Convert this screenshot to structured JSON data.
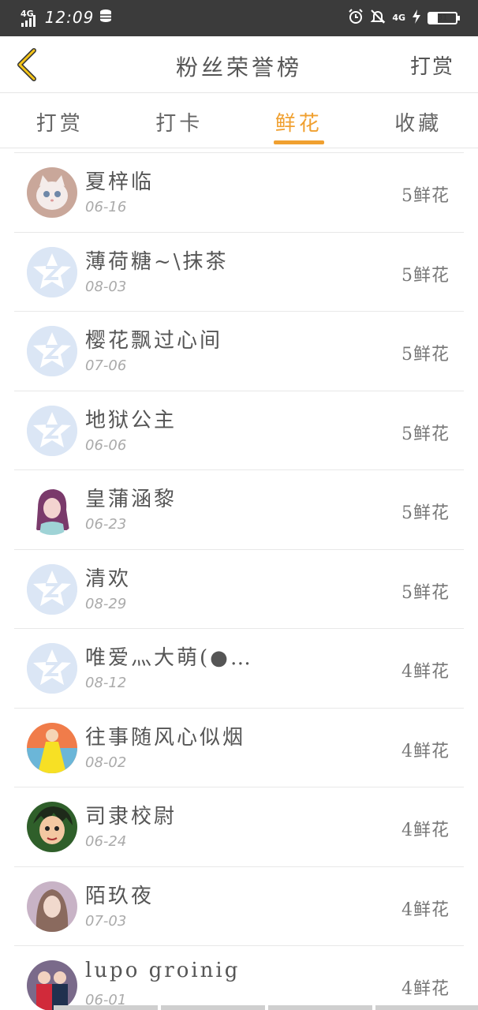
{
  "status_bar": {
    "network": "4G",
    "time": "12:09",
    "network_right": "4G",
    "battery": "31",
    "battery_level": 0.31
  },
  "header": {
    "title": "粉丝荣誉榜",
    "action": "打赏"
  },
  "tabs": [
    {
      "label": "打赏",
      "active": false
    },
    {
      "label": "打卡",
      "active": false
    },
    {
      "label": "鲜花",
      "active": true
    },
    {
      "label": "收藏",
      "active": false
    }
  ],
  "rows": [
    {
      "name": "夏梓临",
      "date": "06-16",
      "value": "5鲜花",
      "avatar": "cat-photo"
    },
    {
      "name": "薄荷糖~\\抹茶",
      "date": "08-03",
      "value": "5鲜花",
      "avatar": "default-star"
    },
    {
      "name": "樱花飘过心间",
      "date": "07-06",
      "value": "5鲜花",
      "avatar": "default-star"
    },
    {
      "name": "地狱公主",
      "date": "06-06",
      "value": "5鲜花",
      "avatar": "default-star"
    },
    {
      "name": "皇蒲涵黎",
      "date": "06-23",
      "value": "5鲜花",
      "avatar": "anime-girl"
    },
    {
      "name": "清欢",
      "date": "08-29",
      "value": "5鲜花",
      "avatar": "default-star"
    },
    {
      "name": "唯爱灬大萌(●…",
      "date": "08-12",
      "value": "4鲜花",
      "avatar": "default-star"
    },
    {
      "name": "往事随风心似烟",
      "date": "08-02",
      "value": "4鲜花",
      "avatar": "yellow-dress"
    },
    {
      "name": "司隶校尉",
      "date": "06-24",
      "value": "4鲜花",
      "avatar": "cartoon-boy"
    },
    {
      "name": "陌玖夜",
      "date": "07-03",
      "value": "4鲜花",
      "avatar": "girl-portrait"
    },
    {
      "name": "lupo groinig",
      "date": "06-01",
      "value": "4鲜花",
      "avatar": "couple-photo"
    }
  ],
  "colors": {
    "accent": "#f0a030",
    "status_bar": "#3b3b3b",
    "default_avatar": "#dbe6f5"
  }
}
